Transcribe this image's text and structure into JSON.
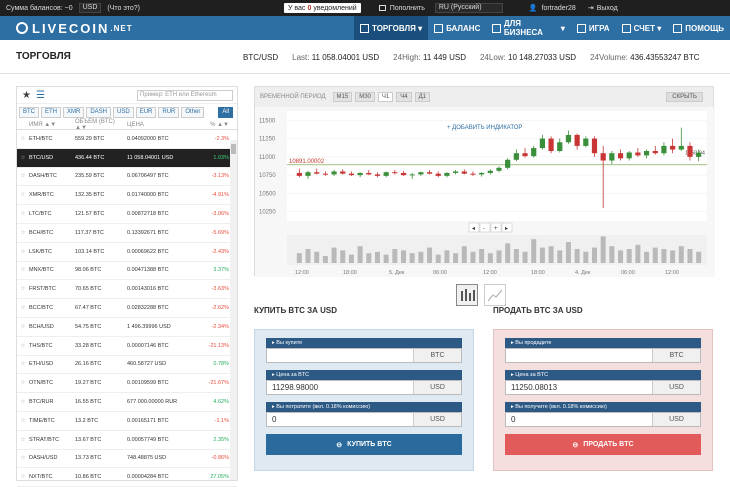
{
  "topbar": {
    "balance_label": "Сумма балансов: ~0",
    "currency": "USD",
    "whats_this": "(Что это?)",
    "notif_pre": "У вас",
    "notif_count": "0",
    "notif_post": "уведомлений",
    "deposit": "Пополнить",
    "language": "RU (Русский)",
    "username": "fortrader28",
    "logout": "Выход"
  },
  "navbar": {
    "logo": "LIVECOIN",
    "logo_suffix": ".NET",
    "menu": [
      {
        "label": "ТОРГОВЛЯ",
        "icon": "chart-icon"
      },
      {
        "label": "БАЛАНС",
        "icon": "wallet-icon"
      },
      {
        "label": "ДЛЯ БИЗНЕСА",
        "icon": "briefcase-icon"
      },
      {
        "label": "ИГРА",
        "icon": "gamepad-icon"
      },
      {
        "label": "СЧЕТ",
        "icon": "user-icon"
      },
      {
        "label": "ПОМОЩЬ",
        "icon": "help-icon"
      }
    ]
  },
  "header": {
    "title": "ТОРГОВЛЯ",
    "pair": "BTC/USD",
    "last_label": "Last:",
    "last": "11 058.04001 USD",
    "high_label": "24High:",
    "high": "11 449 USD",
    "low_label": "24Low:",
    "low": "10 148.27033 USD",
    "volume_label": "24Volume:",
    "volume": "436.43553247 BTC"
  },
  "markets": {
    "search_placeholder": "Пример: ETH или Ethereum",
    "tabs": [
      "BTC",
      "ETH",
      "XMR",
      "DASH",
      "USD",
      "EUR",
      "RUR",
      "Other"
    ],
    "all_tab": "All",
    "columns": {
      "name": "ИМЯ ▲▼",
      "volume": "ОБЪЕМ (BTC) ▲▼",
      "price": "ЦЕНА",
      "change": "% ▲▼"
    },
    "rows": [
      {
        "name": "ETH/BTC",
        "volume": "559.29 BTC",
        "price": "0.04092000 BTC",
        "change": "-2.3%",
        "dir": "neg"
      },
      {
        "name": "BTC/USD",
        "volume": "436.44 BTC",
        "price": "11 058.04001 USD",
        "change": "1.03%",
        "dir": "pos"
      },
      {
        "name": "DASH/BTC",
        "volume": "235.59 BTC",
        "price": "0.06706497 BTC",
        "change": "-3.13%",
        "dir": "neg"
      },
      {
        "name": "XMR/BTC",
        "volume": "132.35 BTC",
        "price": "0.01740000 BTC",
        "change": "-4.91%",
        "dir": "neg"
      },
      {
        "name": "LTC/BTC",
        "volume": "121.57 BTC",
        "price": "0.00872718 BTC",
        "change": "-3.06%",
        "dir": "neg"
      },
      {
        "name": "BCH/BTC",
        "volume": "117.37 BTC",
        "price": "0.13392671 BTC",
        "change": "-5.69%",
        "dir": "neg"
      },
      {
        "name": "LSK/BTC",
        "volume": "103.14 BTC",
        "price": "0.00069622 BTC",
        "change": "-2.43%",
        "dir": "neg"
      },
      {
        "name": "MNX/BTC",
        "volume": "98.06 BTC",
        "price": "0.00471388 BTC",
        "change": "3.37%",
        "dir": "pos"
      },
      {
        "name": "FRST/BTC",
        "volume": "70.65 BTC",
        "price": "0.00143016 BTC",
        "change": "-3.63%",
        "dir": "neg"
      },
      {
        "name": "BCC/BTC",
        "volume": "67.47 BTC",
        "price": "0.02832288 BTC",
        "change": "-2.62%",
        "dir": "neg"
      },
      {
        "name": "BCH/USD",
        "volume": "54.75 BTC",
        "price": "1 496.39996 USD",
        "change": "-2.34%",
        "dir": "neg"
      },
      {
        "name": "THS/BTC",
        "volume": "33.28 BTC",
        "price": "0.00007146 BTC",
        "change": "-21.13%",
        "dir": "neg"
      },
      {
        "name": "ETH/USD",
        "volume": "26.16 BTC",
        "price": "460.58727 USD",
        "change": "0.78%",
        "dir": "pos"
      },
      {
        "name": "OTN/BTC",
        "volume": "19.27 BTC",
        "price": "0.00109599 BTC",
        "change": "-21.67%",
        "dir": "neg"
      },
      {
        "name": "BTC/RUR",
        "volume": "16.55 BTC",
        "price": "677 000.00000 RUR",
        "change": "4.62%",
        "dir": "pos"
      },
      {
        "name": "TIME/BTC",
        "volume": "13.2 BTC",
        "price": "0.00165171 BTC",
        "change": "-1.1%",
        "dir": "neg"
      },
      {
        "name": "STRAT/BTC",
        "volume": "13.67 BTC",
        "price": "0.00057749 BTC",
        "change": "2.35%",
        "dir": "pos"
      },
      {
        "name": "DASH/USD",
        "volume": "13.73 BTC",
        "price": "748.48875 USD",
        "change": "-0.86%",
        "dir": "neg"
      },
      {
        "name": "NXT/BTC",
        "volume": "10.86 BTC",
        "price": "0.00004284 BTC",
        "change": "27.05%",
        "dir": "pos"
      }
    ]
  },
  "chart": {
    "period_label": "ВРЕМЕННОЙ ПЕРИОД",
    "periods": [
      "M15",
      "M30",
      "Ч1",
      "Ч4",
      "Д1"
    ],
    "active_period": "Ч1",
    "hide_label": "СКРЫТЬ",
    "add_indicator": "+ ДОБАВИТЬ ИНДИКАТОР",
    "nav_buttons": [
      "◂",
      "-",
      "+",
      "▸"
    ],
    "price_marker": "10891.00002",
    "last_marker": "1058.04",
    "y_ticks": [
      "11500",
      "11250",
      "11000",
      "10750",
      "10500",
      "10250"
    ],
    "x_ticks": [
      "12:00",
      "18:00",
      "5. Дек",
      "06:00",
      "12:00",
      "18:00",
      "4. Дек",
      "06:00",
      "12:00"
    ],
    "colors": {
      "up": "#3a8f3a",
      "down": "#c93434"
    }
  },
  "chart_data": {
    "type": "candlestick",
    "ylim": [
      10150,
      11600
    ],
    "candles": [
      {
        "o": 10780,
        "h": 10840,
        "l": 10720,
        "c": 10740
      },
      {
        "o": 10740,
        "h": 10810,
        "l": 10700,
        "c": 10790
      },
      {
        "o": 10790,
        "h": 10840,
        "l": 10760,
        "c": 10770
      },
      {
        "o": 10770,
        "h": 10800,
        "l": 10740,
        "c": 10760
      },
      {
        "o": 10760,
        "h": 10820,
        "l": 10740,
        "c": 10800
      },
      {
        "o": 10800,
        "h": 10830,
        "l": 10760,
        "c": 10770
      },
      {
        "o": 10770,
        "h": 10800,
        "l": 10740,
        "c": 10750
      },
      {
        "o": 10750,
        "h": 10790,
        "l": 10720,
        "c": 10780
      },
      {
        "o": 10780,
        "h": 10820,
        "l": 10750,
        "c": 10760
      },
      {
        "o": 10760,
        "h": 10790,
        "l": 10720,
        "c": 10740
      },
      {
        "o": 10740,
        "h": 10800,
        "l": 10720,
        "c": 10790
      },
      {
        "o": 10790,
        "h": 10820,
        "l": 10760,
        "c": 10780
      },
      {
        "o": 10780,
        "h": 10810,
        "l": 10740,
        "c": 10750
      },
      {
        "o": 10750,
        "h": 10780,
        "l": 10700,
        "c": 10760
      },
      {
        "o": 10760,
        "h": 10800,
        "l": 10740,
        "c": 10790
      },
      {
        "o": 10790,
        "h": 10820,
        "l": 10760,
        "c": 10770
      },
      {
        "o": 10770,
        "h": 10800,
        "l": 10720,
        "c": 10740
      },
      {
        "o": 10740,
        "h": 10790,
        "l": 10720,
        "c": 10780
      },
      {
        "o": 10780,
        "h": 10820,
        "l": 10760,
        "c": 10800
      },
      {
        "o": 10800,
        "h": 10830,
        "l": 10760,
        "c": 10770
      },
      {
        "o": 10770,
        "h": 10800,
        "l": 10740,
        "c": 10760
      },
      {
        "o": 10760,
        "h": 10790,
        "l": 10730,
        "c": 10780
      },
      {
        "o": 10780,
        "h": 10830,
        "l": 10760,
        "c": 10810
      },
      {
        "o": 10810,
        "h": 10870,
        "l": 10790,
        "c": 10850
      },
      {
        "o": 10850,
        "h": 10980,
        "l": 10830,
        "c": 10960
      },
      {
        "o": 10960,
        "h": 11100,
        "l": 10940,
        "c": 11050
      },
      {
        "o": 11050,
        "h": 11120,
        "l": 10990,
        "c": 11010
      },
      {
        "o": 11010,
        "h": 11150,
        "l": 10990,
        "c": 11120
      },
      {
        "o": 11120,
        "h": 11300,
        "l": 11100,
        "c": 11250
      },
      {
        "o": 11250,
        "h": 11280,
        "l": 11050,
        "c": 11080
      },
      {
        "o": 11080,
        "h": 11250,
        "l": 11060,
        "c": 11200
      },
      {
        "o": 11200,
        "h": 11360,
        "l": 11180,
        "c": 11300
      },
      {
        "o": 11300,
        "h": 11320,
        "l": 11100,
        "c": 11150
      },
      {
        "o": 11150,
        "h": 11280,
        "l": 11130,
        "c": 11250
      },
      {
        "o": 11250,
        "h": 11280,
        "l": 11000,
        "c": 11050
      },
      {
        "o": 11050,
        "h": 11150,
        "l": 10300,
        "c": 10950
      },
      {
        "o": 10950,
        "h": 11080,
        "l": 10900,
        "c": 11050
      },
      {
        "o": 11050,
        "h": 11100,
        "l": 10950,
        "c": 10980
      },
      {
        "o": 10980,
        "h": 11080,
        "l": 10950,
        "c": 11060
      },
      {
        "o": 11060,
        "h": 11120,
        "l": 11000,
        "c": 11020
      },
      {
        "o": 11020,
        "h": 11100,
        "l": 10980,
        "c": 11080
      },
      {
        "o": 11080,
        "h": 11150,
        "l": 11030,
        "c": 11050
      },
      {
        "o": 11050,
        "h": 11200,
        "l": 11020,
        "c": 11150
      },
      {
        "o": 11150,
        "h": 11250,
        "l": 11050,
        "c": 11100
      },
      {
        "o": 11100,
        "h": 11400,
        "l": 11080,
        "c": 11150
      },
      {
        "o": 11150,
        "h": 11200,
        "l": 10950,
        "c": 11000
      },
      {
        "o": 11000,
        "h": 11100,
        "l": 10940,
        "c": 11058
      }
    ],
    "volumes": [
      0.35,
      0.5,
      0.4,
      0.25,
      0.55,
      0.45,
      0.3,
      0.6,
      0.35,
      0.4,
      0.3,
      0.5,
      0.45,
      0.35,
      0.4,
      0.55,
      0.3,
      0.45,
      0.35,
      0.6,
      0.4,
      0.5,
      0.35,
      0.45,
      0.7,
      0.5,
      0.4,
      0.85,
      0.55,
      0.6,
      0.45,
      0.75,
      0.5,
      0.4,
      0.55,
      0.95,
      0.6,
      0.45,
      0.5,
      0.65,
      0.4,
      0.55,
      0.5,
      0.45,
      0.6,
      0.5,
      0.4
    ]
  },
  "buy": {
    "title": "КУПИТЬ BTC ЗА USD",
    "f1_label": "Вы купите",
    "f1_value": "",
    "f1_cur": "BTC",
    "f2_label": "Цена за BTC",
    "f2_value": "11298.98000",
    "f2_cur": "USD",
    "f3_label": "Вы потратите (вкл. 0.18% комиссию)",
    "f3_value": "0",
    "f3_cur": "USD",
    "button": "КУПИТЬ BTC"
  },
  "sell": {
    "title": "ПРОДАТЬ BTC ЗА USD",
    "f1_label": "Вы продадите",
    "f1_value": "",
    "f1_cur": "BTC",
    "f2_label": "Цена за BTC",
    "f2_value": "11250.08013",
    "f2_cur": "USD",
    "f3_label": "Вы получите (вкл. 0.18% комиссию)",
    "f3_value": "0",
    "f3_cur": "USD",
    "button": "ПРОДАТЬ BTC"
  }
}
